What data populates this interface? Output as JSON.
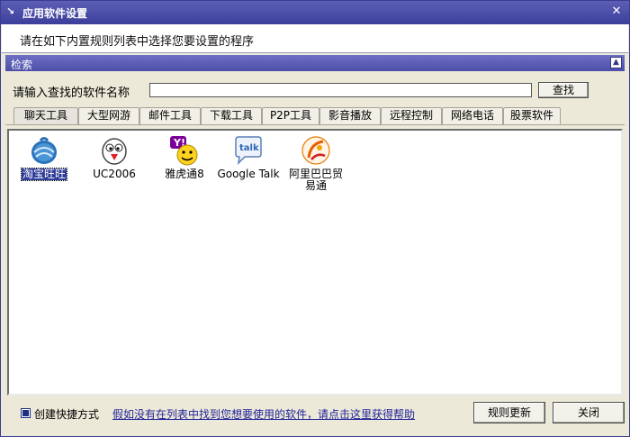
{
  "window": {
    "title": "应用软件设置",
    "close_glyph": "✕",
    "subtitle": "请在如下内置规则列表中选择您要设置的程序"
  },
  "search": {
    "header": "检索",
    "prompt": "请输入查找的软件名称",
    "value": "",
    "button": "查找"
  },
  "tabs": [
    {
      "label": "聊天工具",
      "active": true
    },
    {
      "label": "大型网游"
    },
    {
      "label": "邮件工具"
    },
    {
      "label": "下载工具"
    },
    {
      "label": "P2P工具"
    },
    {
      "label": "影音播放"
    },
    {
      "label": "远程控制"
    },
    {
      "label": "网络电话"
    },
    {
      "label": "股票软件"
    }
  ],
  "apps": [
    {
      "name": "淘宝旺旺",
      "icon": "wangwang-icon",
      "selected": true
    },
    {
      "name": "UC2006",
      "icon": "uc-penguin-icon"
    },
    {
      "name": "雅虎通8",
      "icon": "yahoo-messenger-icon"
    },
    {
      "name": "Google Talk",
      "icon": "google-talk-icon"
    },
    {
      "name": "阿里巴巴贸易通",
      "icon": "alibaba-trademanager-icon"
    }
  ],
  "footer": {
    "shortcut_label": "创建快捷方式",
    "shortcut_checked": true,
    "help_link": "假如没有在列表中找到您想要使用的软件，请点击这里获得帮助",
    "update_button": "规则更新",
    "close_button": "关闭"
  },
  "colors": {
    "titlebar": "#3c3f9a",
    "panel_header": "#4b4ea8",
    "selection": "#2f3c99",
    "link": "#22229a"
  }
}
